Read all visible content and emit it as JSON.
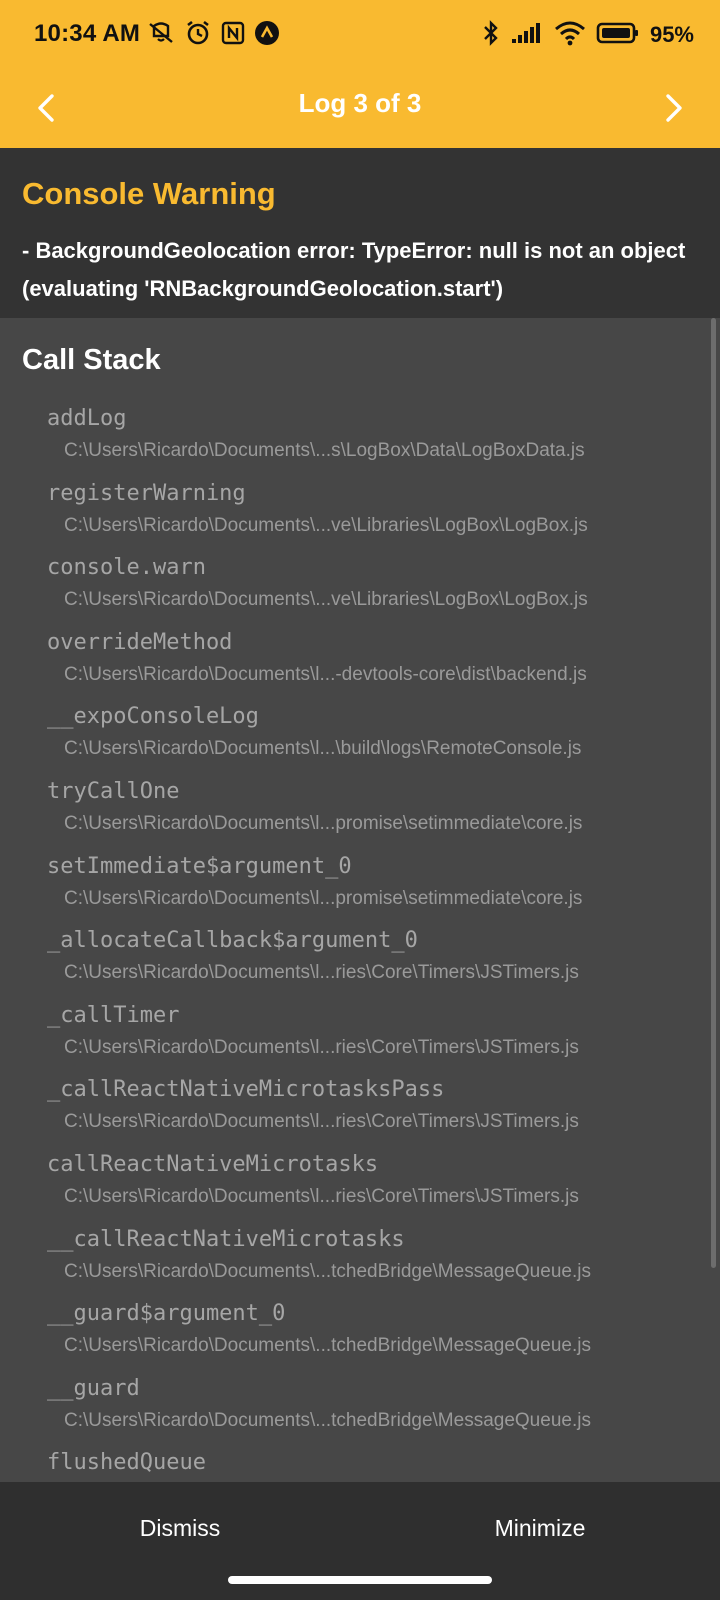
{
  "status_bar": {
    "time": "10:34 AM",
    "battery": "95%",
    "icons_left": [
      "mute-vibrate-icon",
      "alarm-icon",
      "nfc-icon",
      "app-notification-icon"
    ],
    "icons_right": [
      "bluetooth-icon",
      "signal-icon",
      "wifi-icon",
      "battery-icon"
    ]
  },
  "header": {
    "title": "Log 3 of 3",
    "prev_icon": "chevron-left-icon",
    "next_icon": "chevron-right-icon",
    "color": "#F9BA30"
  },
  "warning": {
    "title": "Console Warning",
    "message": "- BackgroundGeolocation error:  TypeError: null is not an object (evaluating 'RNBackgroundGeolocation.start')",
    "title_color": "#F9BA30"
  },
  "callstack": {
    "title": "Call Stack",
    "frames": [
      {
        "name": "addLog",
        "path": "C:\\Users\\Ricardo\\Documents\\...s\\LogBox\\Data\\LogBoxData.js"
      },
      {
        "name": "registerWarning",
        "path": "C:\\Users\\Ricardo\\Documents\\...ve\\Libraries\\LogBox\\LogBox.js"
      },
      {
        "name": "console.warn",
        "path": "C:\\Users\\Ricardo\\Documents\\...ve\\Libraries\\LogBox\\LogBox.js"
      },
      {
        "name": "overrideMethod",
        "path": "C:\\Users\\Ricardo\\Documents\\l...-devtools-core\\dist\\backend.js"
      },
      {
        "name": "__expoConsoleLog",
        "path": "C:\\Users\\Ricardo\\Documents\\l...\\build\\logs\\RemoteConsole.js"
      },
      {
        "name": "tryCallOne",
        "path": "C:\\Users\\Ricardo\\Documents\\l...promise\\setimmediate\\core.js"
      },
      {
        "name": "setImmediate$argument_0",
        "path": "C:\\Users\\Ricardo\\Documents\\l...promise\\setimmediate\\core.js"
      },
      {
        "name": "_allocateCallback$argument_0",
        "path": "C:\\Users\\Ricardo\\Documents\\l...ries\\Core\\Timers\\JSTimers.js"
      },
      {
        "name": "_callTimer",
        "path": "C:\\Users\\Ricardo\\Documents\\l...ries\\Core\\Timers\\JSTimers.js"
      },
      {
        "name": "_callReactNativeMicrotasksPass",
        "path": "C:\\Users\\Ricardo\\Documents\\l...ries\\Core\\Timers\\JSTimers.js"
      },
      {
        "name": "callReactNativeMicrotasks",
        "path": "C:\\Users\\Ricardo\\Documents\\l...ries\\Core\\Timers\\JSTimers.js"
      },
      {
        "name": "__callReactNativeMicrotasks",
        "path": "C:\\Users\\Ricardo\\Documents\\...tchedBridge\\MessageQueue.js"
      },
      {
        "name": "__guard$argument_0",
        "path": "C:\\Users\\Ricardo\\Documents\\...tchedBridge\\MessageQueue.js"
      },
      {
        "name": "__guard",
        "path": "C:\\Users\\Ricardo\\Documents\\...tchedBridge\\MessageQueue.js"
      },
      {
        "name": "flushedQueue",
        "path": ""
      }
    ]
  },
  "bottom_bar": {
    "dismiss_label": "Dismiss",
    "minimize_label": "Minimize"
  }
}
